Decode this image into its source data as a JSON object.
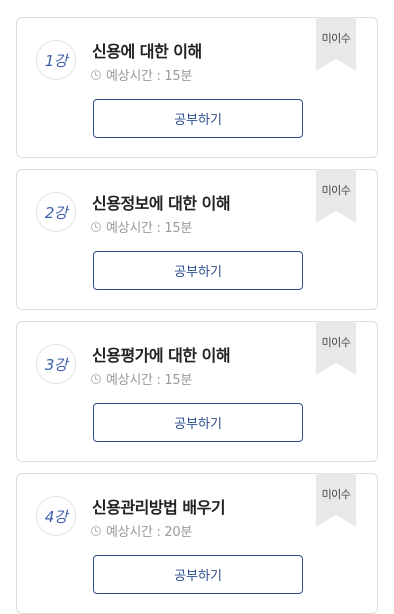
{
  "lessons": [
    {
      "number": "1강",
      "title": "신용에 대한 이해",
      "time": "예상시간 : 15분",
      "button": "공부하기",
      "status": "미이수"
    },
    {
      "number": "2강",
      "title": "신용정보에 대한 이해",
      "time": "예상시간 : 15분",
      "button": "공부하기",
      "status": "미이수"
    },
    {
      "number": "3강",
      "title": "신용평가에 대한 이해",
      "time": "예상시간 : 15분",
      "button": "공부하기",
      "status": "미이수"
    },
    {
      "number": "4강",
      "title": "신용관리방법 배우기",
      "time": "예상시간 : 20분",
      "button": "공부하기",
      "status": "미이수"
    }
  ]
}
